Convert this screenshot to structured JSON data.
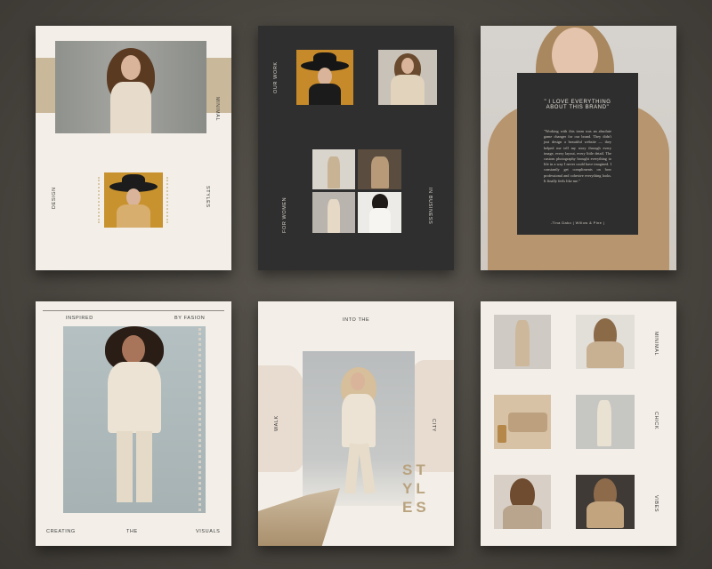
{
  "card1": {
    "label_minimal": "MINIMAL",
    "label_design": "DESIGN",
    "label_styles": "STYLES"
  },
  "card2": {
    "label_our_work": "OUR WORK",
    "label_for_women": "FOR WOMEN",
    "label_in_business": "IN BUSINESS"
  },
  "card3": {
    "quote_title": "\" I LOVE EVERYTHING ABOUT THIS BRAND\"",
    "quote_body": "\"Working with this team was an absolute game changer for our brand. They didn't just design a beautiful website — they helped me tell my story through every image, every layout, every little detail. The custom photography brought everything to life in a way I never could have imagined. I constantly get compliments on how professional and cohesive everything looks. It finally feels like me.\"",
    "quote_author": "-Tina Dako | Willow & Pine |"
  },
  "card4": {
    "label_inspired": "INSPIRED",
    "label_by_fasion": "BY FASION",
    "label_creating": "CREATING",
    "label_the": "THE",
    "label_visuals": "VISUALS"
  },
  "card5": {
    "label_into_the": "INTO THE",
    "label_walk": "WALK",
    "label_city": "CITY",
    "styles_line1": "ST",
    "styles_line2": "YL",
    "styles_line3": "ES"
  },
  "card6": {
    "label_minimal": "MINIMAL",
    "label_chick": "CHICK",
    "label_vibes": "VIBES"
  },
  "colors": {
    "background": "#4a4640",
    "cream": "#f3efe8",
    "dark_panel": "#2f2f2f",
    "accent_tan": "#b9a37f",
    "accent_mustard": "#c8922e"
  }
}
